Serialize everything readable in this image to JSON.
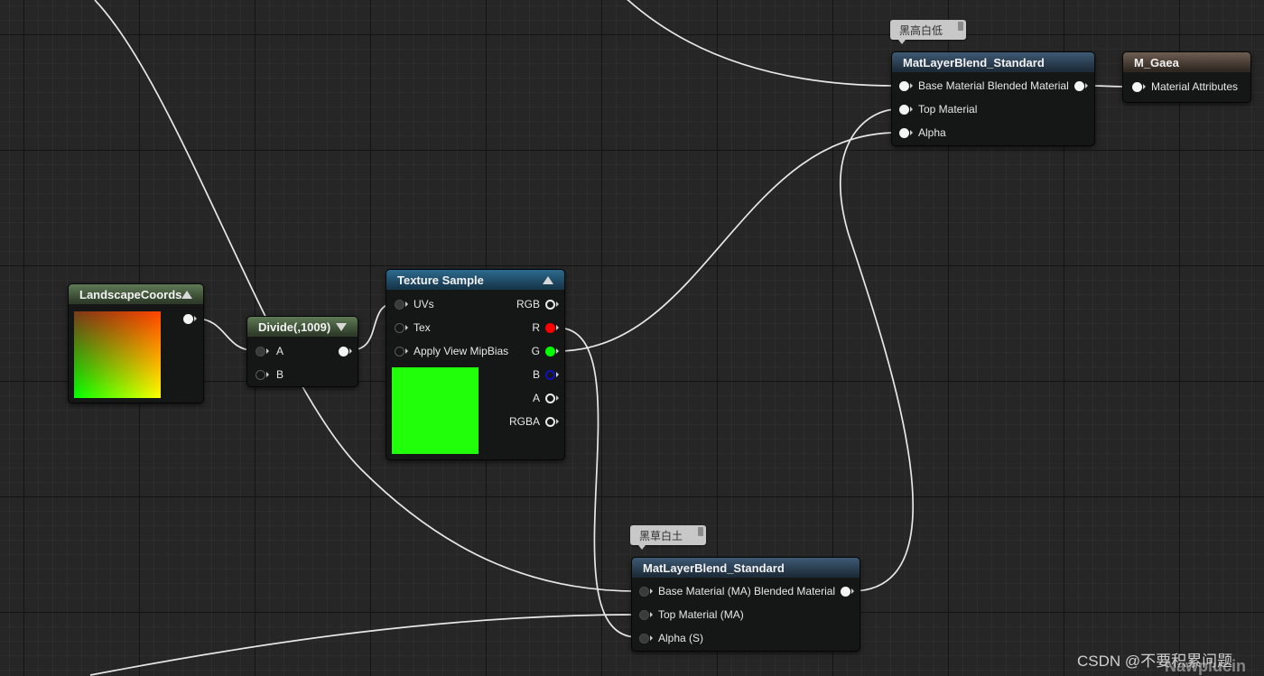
{
  "nodes": {
    "blend_top": {
      "title": "MatLayerBlend_Standard",
      "comment": "黑高白低",
      "pins": {
        "base": "Base Material Blended Material",
        "top": "Top Material",
        "alpha": "Alpha"
      }
    },
    "output": {
      "title": "M_Gaea",
      "pins": {
        "attributes": "Material Attributes"
      }
    },
    "landscape": {
      "title": "LandscapeCoords",
      "preview_colors": {
        "top_left": "#7a3a18",
        "top_right": "#ff4400",
        "bottom_left": "#00ff00",
        "bottom_right": "#ffff00"
      }
    },
    "divide": {
      "title": "Divide(,1009)",
      "pins": {
        "a": "A",
        "b": "B"
      }
    },
    "texture": {
      "title": "Texture Sample",
      "pins": {
        "uvs": "UVs",
        "tex": "Tex",
        "mip": "Apply View MipBias",
        "rgb": "RGB",
        "r": "R",
        "g": "G",
        "b": "B",
        "a": "A",
        "rgba": "RGBA"
      },
      "preview_color": "#22ff0a",
      "channel_colors": {
        "r": "#ff0000",
        "g": "#00ff00",
        "b": "#0000ff"
      }
    },
    "blend_bottom": {
      "title": "MatLayerBlend_Standard",
      "comment": "黑草白土",
      "pins": {
        "base": "Base Material (MA) Blended Material",
        "top": "Top Material (MA)",
        "alpha": "Alpha (S)"
      }
    }
  },
  "watermark": {
    "text": "CSDN @不要积累问题",
    "bg_text_1": "Nawplucin"
  },
  "colors": {
    "canvas": "#262626",
    "wire": "#e8e8e8"
  }
}
